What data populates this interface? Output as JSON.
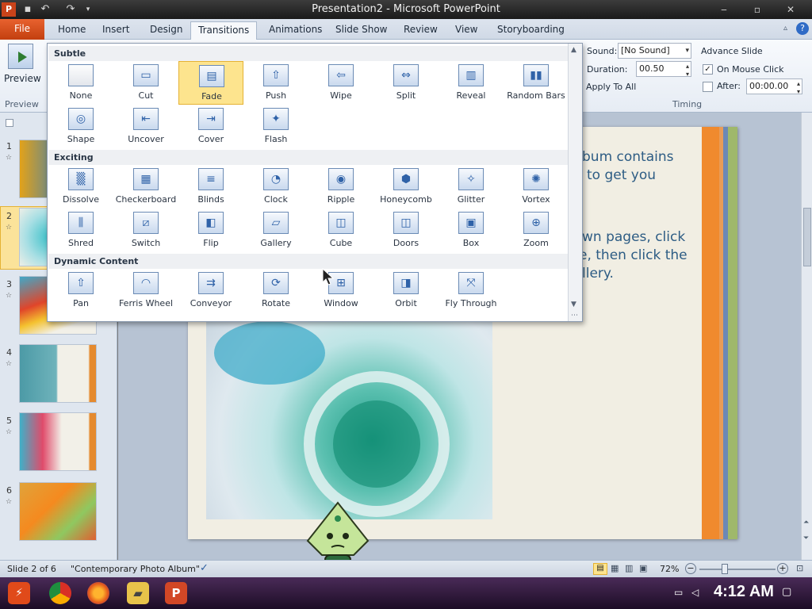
{
  "window": {
    "title": "Presentation2 - Microsoft PowerPoint",
    "minimize": "‒",
    "maximize": "▫",
    "close": "✕"
  },
  "ribbon_tabs": {
    "file": "File",
    "tabs": [
      "Home",
      "Insert",
      "Design",
      "Transitions",
      "Animations",
      "Slide Show",
      "Review",
      "View",
      "Storyboarding"
    ],
    "active_tab": "Transitions"
  },
  "ribbon": {
    "preview_label": "Preview",
    "preview_group": "Preview",
    "sound_label": "Sound:",
    "sound_value": "[No Sound]",
    "duration_label": "Duration:",
    "duration_value": "00.50",
    "apply_all_label": "Apply To All",
    "advance_slide_label": "Advance Slide",
    "on_mouse_click_label": "On Mouse Click",
    "on_mouse_click_checked": true,
    "after_label": "After:",
    "after_value": "00:00.00",
    "timing_group": "Timing"
  },
  "gallery": {
    "sections": [
      {
        "title": "Subtle",
        "items": [
          "None",
          "Cut",
          "Fade",
          "Push",
          "Wipe",
          "Split",
          "Reveal",
          "Random Bars",
          "Shape",
          "Uncover",
          "Cover",
          "Flash"
        ]
      },
      {
        "title": "Exciting",
        "items": [
          "Dissolve",
          "Checkerboard",
          "Blinds",
          "Clock",
          "Ripple",
          "Honeycomb",
          "Glitter",
          "Vortex",
          "Shred",
          "Switch",
          "Flip",
          "Gallery",
          "Cube",
          "Doors",
          "Box",
          "Zoom"
        ]
      },
      {
        "title": "Dynamic Content",
        "items": [
          "Pan",
          "Ferris Wheel",
          "Conveyor",
          "Rotate",
          "Window",
          "Orbit",
          "Fly Through"
        ]
      }
    ],
    "selected": "Fade"
  },
  "slides_panel": {
    "numbers": [
      "1",
      "2",
      "3",
      "4",
      "5",
      "6"
    ],
    "selected_index": 1
  },
  "slide": {
    "text_lines": [
      "bum contains",
      "to get you",
      "",
      "wn pages, click",
      "e, then click the",
      "llery."
    ]
  },
  "statusbar": {
    "slide_info": "Slide 2 of 6",
    "theme": "\"Contemporary Photo Album\"",
    "zoom": "72%"
  },
  "taskbar": {
    "clock": "4:12 AM"
  }
}
